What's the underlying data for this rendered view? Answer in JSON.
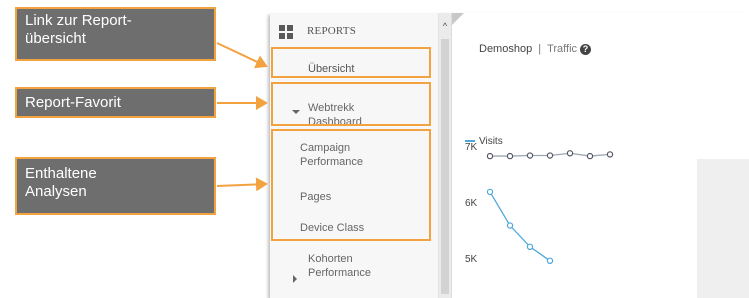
{
  "sidebar": {
    "title": "REPORTS",
    "overview": "Übersicht",
    "favorite": {
      "line1": "Webtrekk",
      "line2": "Dashboard"
    },
    "analyses": [
      {
        "line1": "Campaign",
        "line2": "Performance"
      },
      {
        "line1": "Pages",
        "line2": ""
      },
      {
        "line1": "Device Class",
        "line2": ""
      }
    ],
    "next_report": {
      "line1": "Kohorten",
      "line2": "Performance"
    }
  },
  "header": {
    "site": "Demoshop",
    "section": "Traffic",
    "help": "?"
  },
  "annotations": {
    "report_overview_link": {
      "line1": "Link zur Report-",
      "line2": "übersicht"
    },
    "report_favorite": "Report-Favorit",
    "contained_analyses": {
      "line1": "Enthaltene",
      "line2": "Analysen"
    },
    "highlight_color": "#f3a240",
    "callout_bg": "#6e6e6e"
  },
  "chart_data": {
    "type": "line",
    "legend": "Visits",
    "y_ticks": [
      "7K",
      "6K",
      "5K"
    ],
    "y_tick_values": [
      7000,
      6000,
      5000
    ],
    "series": [
      {
        "name": "Visits",
        "color": "#9aa7b1",
        "values": [
          6820,
          6820,
          6830,
          6830,
          6870,
          6820,
          6850
        ]
      },
      {
        "name": "",
        "color": "#4ea8dc",
        "values": [
          6180,
          5580,
          5200,
          4950
        ]
      }
    ],
    "x_count": 7,
    "ylim": [
      4900,
      7000
    ]
  }
}
